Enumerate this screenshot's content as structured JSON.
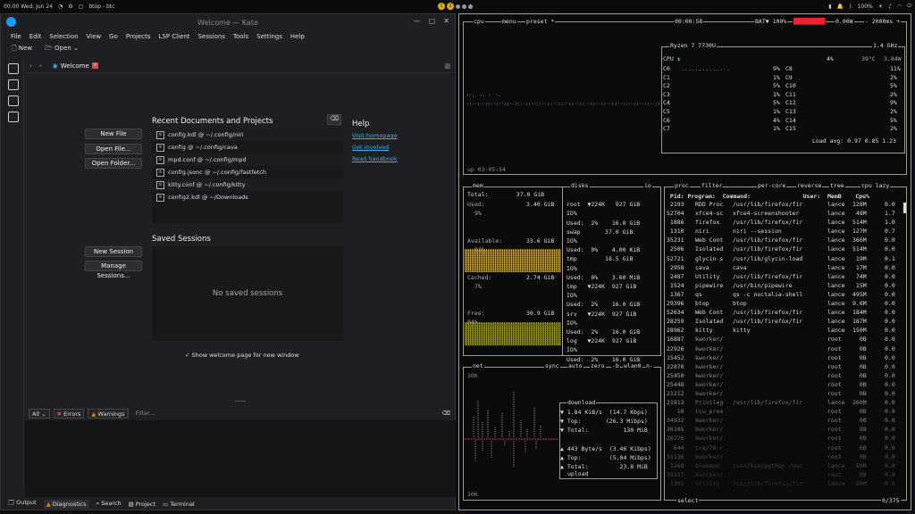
{
  "topbar": {
    "clock": "00:00 Wed, Jun 24",
    "window_title": "btop - btc",
    "workspaces": [
      "1",
      "2",
      "",
      "",
      ""
    ],
    "battery": "100%"
  },
  "kate": {
    "title": "Welcome — Kate",
    "menu": [
      "File",
      "Edit",
      "Selection",
      "View",
      "Go",
      "Projects",
      "LSP Client",
      "Sessions",
      "Tools",
      "Settings",
      "Help"
    ],
    "toolbar": {
      "new": "New",
      "open": "Open"
    },
    "tab": "Welcome",
    "buttons": {
      "new_file": "New File",
      "open_file": "Open File...",
      "open_folder": "Open Folder...",
      "new_session": "New Session",
      "manage_sessions": "Manage Sessions..."
    },
    "recent_title": "Recent Documents and Projects",
    "recent": [
      "config.kdl @ ~/.config/niri",
      "config @ ~/.config/cava",
      "mpd.conf @ ~/.config/mpd",
      "config.jsonc @ ~/.config/fastfetch",
      "kitty.conf @ ~/.config/kitty",
      "config2.kdl @ ~/Downloads"
    ],
    "help": {
      "title": "Help",
      "links": [
        "Visit homepage",
        "Get involved",
        "Read handbook"
      ]
    },
    "sessions_title": "Saved Sessions",
    "no_sessions": "No saved sessions",
    "show_welcome": "✓  Show welcome page for new window",
    "diag": {
      "all": "All",
      "errors": "Errors",
      "warnings": "Warnings",
      "filter": "Filter..."
    },
    "bottom_tabs": [
      "Output",
      "Diagnostics",
      "Search",
      "Project",
      "Terminal"
    ]
  },
  "btop": {
    "header": {
      "cpu": "cpu",
      "menu": "menu",
      "preset": "preset *",
      "time": "00:00:58",
      "bat": "BAT▼ 100%",
      "power": "0.00W",
      "interval": "- 2000ms +"
    },
    "cpu_name": "Ryzen 7 7730U",
    "freq": "1.4 GHz",
    "cpu_total": "4%",
    "cpu_temp": "39°C",
    "cpu_power": "3.84W",
    "cores": [
      [
        "C0",
        "9%",
        "C8",
        "11%"
      ],
      [
        "C1",
        "1%",
        "C9",
        "2%"
      ],
      [
        "C2",
        "5%",
        "C10",
        "5%"
      ],
      [
        "C3",
        "1%",
        "C11",
        "2%"
      ],
      [
        "C4",
        "5%",
        "C12",
        "9%"
      ],
      [
        "C5",
        "1%",
        "C13",
        "2%"
      ],
      [
        "C6",
        "4%",
        "C14",
        "5%"
      ],
      [
        "C7",
        "1%",
        "C15",
        "2%"
      ]
    ],
    "load": "Load avg: 0.97 0.85 1.23",
    "uptime": "up 03:05:54",
    "mem": {
      "title": "mem",
      "total": "Total:        37.0 GiB",
      "used": "Used:",
      "used_v": "3.40 GiB",
      "used_p": "9%",
      "avail": "Available:",
      "avail_v": "33.6 GiB",
      "avail_p": "91%",
      "cached": "Cached:",
      "cached_v": "2.74 GiB",
      "cached_p": "7%",
      "free": "Free:",
      "free_v": "30.9 GiB",
      "free_p": "84%"
    },
    "disks": {
      "title": "disks",
      "io": "io",
      "rows": [
        "root  ▼224K   927 GiB",
        "IO%",
        "Used:  2%    16.0 GiB",
        "swap       37.0 GiB",
        "IO%   ",
        "Used:  0%    4.00 KiB",
        "tmp        18.5 GiB",
        "IO%",
        "Used:  0%    3.60 MiB",
        "tmp   ▼224K  927 GiB",
        "IO%",
        "Used:  2%    16.0 GiB",
        "srv   ▼224K  927 GiB",
        "IO%",
        "Used:  2%    16.0 GiB",
        "log   ▼224K  927 GiB",
        "IO%",
        "Used:  2%    16.0 GiB",
        "cache ▼224K  927 GiB",
        "IO%"
      ]
    },
    "net": {
      "title": "net",
      "sync": "sync",
      "auto": "auto",
      "zero": "zero",
      "b": "-b",
      "iface": "wlan0",
      "n": "n-",
      "top_scale": "10K",
      "bottom_scale": "10K",
      "download": "download",
      "dl_rate": "▼ 1.84 KiB/s  (14.7 Kbps)",
      "dl_top": "▼ Top:       (26.3 Mibps)",
      "dl_total": "▼ Total:          130 MiB",
      "ul_rate": "▲ 443 Byte/s  (3.46 Kibps)",
      "ul_top": "▲ Top:        (5.04 Mibps)",
      "ul_total": "▲ Total:         23.8 MiB",
      "upload": "upload"
    },
    "proc": {
      "title": "proc",
      "filter": "filter",
      "percore": "per-core",
      "reverse": "reverse",
      "tree": "tree",
      "sort": "cpu lazy",
      "header": " Pid: Program:  Command:               User:  MemB    Cpu%",
      "rows": [
        [
          " 2193",
          "RDD Proc",
          "/usr/lib/firefox/fir",
          "lance",
          "128M",
          "0.0"
        ],
        [
          "52704",
          "xfce4-sc",
          "xfce4-screenshooter",
          "lance",
          " 48M",
          "1.7"
        ],
        [
          " 1886",
          "firefox ",
          "/usr/lib/firefox/fir",
          "lance",
          "514M",
          "1.0"
        ],
        [
          " 1310",
          "niri    ",
          "niri --session",
          "lance",
          "127M",
          "0.7"
        ],
        [
          "35231",
          "Web Cont",
          "/usr/lib/firefox/fir",
          "lance",
          "366M",
          "0.0"
        ],
        [
          " 2506",
          "Isolated",
          "/usr/lib/firefox/fir",
          "lance",
          "514M",
          "0.0"
        ],
        [
          "52721",
          "glycin-s",
          "/usr/lib/glycin-load",
          "lance",
          " 19M",
          "0.1"
        ],
        [
          " 2958",
          "cava    ",
          "cava",
          "lance",
          " 17M",
          "0.0"
        ],
        [
          " 2487",
          "Utility ",
          "/usr/lib/firefox/fir",
          "lance",
          " 74M",
          "0.0"
        ],
        [
          " 1524",
          "pipewire",
          "/usr/bin/pipewire",
          "lance",
          " 15M",
          "0.0"
        ],
        [
          " 1367",
          "qs      ",
          "qs -c noctalia-shell",
          "lance",
          "495M",
          "0.0"
        ],
        [
          "29396",
          "btop    ",
          "btop",
          "lance",
          "9.6M",
          "0.0"
        ],
        [
          "52634",
          "Web Cont",
          "/usr/lib/firefox/fir",
          "lance",
          "184M",
          "0.0"
        ],
        [
          "28259",
          "Isolated",
          "/usr/lib/firefox/fir",
          "lance",
          "187M",
          "0.0"
        ],
        [
          "28962",
          "kitty   ",
          "kitty",
          "lance",
          "150M",
          "0.0"
        ],
        [
          "16887",
          "kworker/",
          "",
          "root",
          "  0B",
          "0.0"
        ],
        [
          "22926",
          "kworker/",
          "",
          "root",
          "  0B",
          "0.0"
        ],
        [
          "15452",
          "kworker/",
          "",
          "root",
          "  0B",
          "0.0"
        ],
        [
          "22870",
          "kworker/",
          "",
          "root",
          "  0B",
          "0.0"
        ],
        [
          "25450",
          "kworker/",
          "",
          "root",
          "  0B",
          "0.0"
        ],
        [
          "25448",
          "kworker/",
          "",
          "root",
          "  0B",
          "0.0"
        ],
        [
          "21212",
          "kworker/",
          "",
          "root",
          "  0B",
          "0.0"
        ],
        [
          "21813",
          "Privileg",
          "/usr/lib/firefox/fir",
          "lance",
          "260M",
          "0.0"
        ],
        [
          "   10",
          "rcu_pree",
          "",
          "root",
          "  0B",
          "0.0"
        ],
        [
          "34932",
          "kworker/",
          "",
          "root",
          "  0B",
          "0.0"
        ],
        [
          "36105",
          "kworker/",
          "",
          "root",
          "  0B",
          "0.0"
        ],
        [
          "26776",
          "kworker/",
          "",
          "root",
          "  0B",
          "0.0"
        ],
        [
          "  644",
          "irq/78-r",
          "",
          "root",
          "  0B",
          "0.0"
        ],
        [
          "31136",
          "kworker/",
          "",
          "root",
          "  0B",
          "0.0"
        ],
        [
          " 1368",
          "bluemon",
          "/usr/bin/python /usr",
          "lance",
          " 59M",
          "0.0"
        ],
        [
          "30317",
          "kworker/",
          "",
          "root",
          "  0B",
          "0.0"
        ],
        [
          " 1391",
          "Utility",
          "/usr/lib/firefox/fir",
          "lance",
          " 60M",
          "0.0"
        ]
      ],
      "select": "select",
      "count": "0/375"
    }
  }
}
